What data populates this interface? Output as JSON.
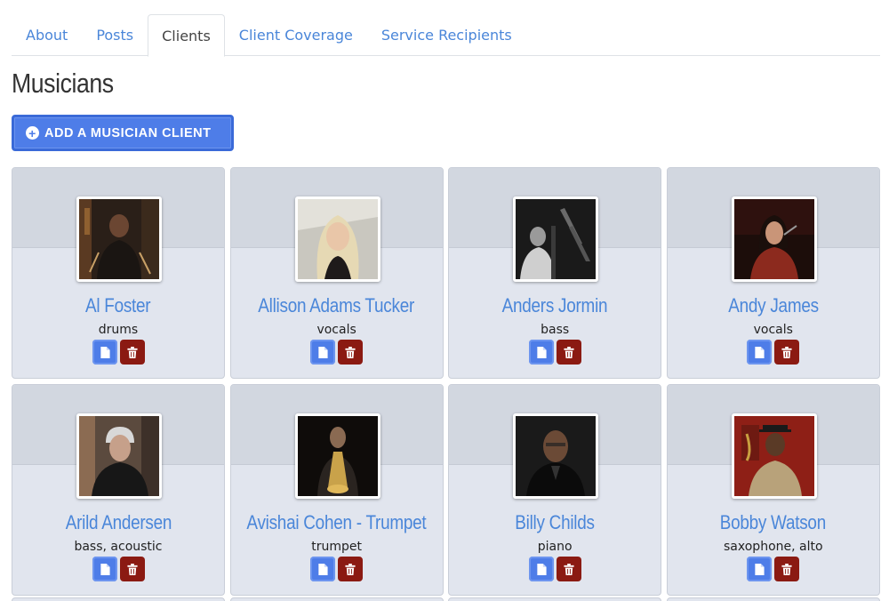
{
  "tabs": [
    {
      "label": "About",
      "active": false
    },
    {
      "label": "Posts",
      "active": false
    },
    {
      "label": "Clients",
      "active": true
    },
    {
      "label": "Client Coverage",
      "active": false
    },
    {
      "label": "Service Recipients",
      "active": false
    }
  ],
  "page_title": "Musicians",
  "add_button_label": "ADD A MUSICIAN CLIENT",
  "colors": {
    "accent": "#4e7de8",
    "link": "#4a86d9",
    "danger": "#8b1a12",
    "card_bg": "#e1e5ee"
  },
  "icons": {
    "add": "plus-circle-icon",
    "view": "file-icon",
    "delete": "trash-icon"
  },
  "clients": [
    {
      "name": "Al Foster",
      "instrument": "drums"
    },
    {
      "name": "Allison Adams Tucker",
      "instrument": "vocals"
    },
    {
      "name": "Anders Jormin",
      "instrument": "bass"
    },
    {
      "name": "Andy James",
      "instrument": "vocals"
    },
    {
      "name": "Arild Andersen",
      "instrument": "bass, acoustic"
    },
    {
      "name": "Avishai Cohen - Trumpet",
      "instrument": "trumpet"
    },
    {
      "name": "Billy Childs",
      "instrument": "piano"
    },
    {
      "name": "Bobby Watson",
      "instrument": "saxophone, alto"
    }
  ]
}
